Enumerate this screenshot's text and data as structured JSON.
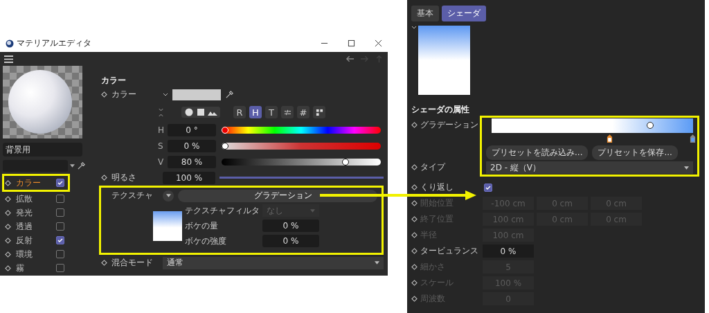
{
  "left_window": {
    "title": "マテリアルエディタ",
    "material_name": "背景用",
    "channels": [
      {
        "label": "カラー",
        "checked": true,
        "selected": true,
        "highlighted": true
      },
      {
        "label": "拡散",
        "checked": false,
        "selected": false,
        "highlighted": false
      },
      {
        "label": "発光",
        "checked": false,
        "selected": false,
        "highlighted": false
      },
      {
        "label": "透過",
        "checked": false,
        "selected": false,
        "highlighted": false
      },
      {
        "label": "反射",
        "checked": true,
        "selected": false,
        "highlighted": false
      },
      {
        "label": "環境",
        "checked": false,
        "selected": false,
        "highlighted": false
      },
      {
        "label": "霧",
        "checked": false,
        "selected": false,
        "highlighted": false
      }
    ],
    "section_title": "カラー",
    "color_label": "カラー",
    "mode_buttons": [
      {
        "kind": "text",
        "label": "R",
        "selected": false
      },
      {
        "kind": "text",
        "label": "H",
        "selected": true
      },
      {
        "kind": "text",
        "label": "T",
        "selected": false
      },
      {
        "kind": "mixer",
        "selected": false
      },
      {
        "kind": "text",
        "label": "#",
        "selected": false
      },
      {
        "kind": "swatches",
        "selected": false
      }
    ],
    "hsv": [
      {
        "kind": "hue",
        "label": "H",
        "value": "0 °",
        "level": 0
      },
      {
        "kind": "saturation",
        "label": "S",
        "value": "0 %",
        "level": 0
      },
      {
        "kind": "value",
        "label": "V",
        "value": "80 %",
        "level": 0.79
      }
    ],
    "brightness": {
      "label": "明るさ",
      "value": "100 %",
      "level": 1
    },
    "texture": {
      "highlighted": true,
      "label": "テクスチャ",
      "shader": "グラデーション",
      "filter_label": "テクスチャフィルタ",
      "filter_value": "なし",
      "blur_amount_label": "ボケの量",
      "blur_amount": "0 %",
      "blur_strength_label": "ボケの強度",
      "blur_strength": "0 %"
    },
    "blend_mode": {
      "label": "混合モード",
      "value": "通常"
    }
  },
  "shader_panel": {
    "tabs": [
      {
        "label": "基本",
        "selected": false
      },
      {
        "label": "シェーダ",
        "selected": true
      }
    ],
    "heading": "シェーダの属性",
    "gradient_label": "グラデーション",
    "gradient_highlighted": true,
    "preset_buttons": [
      "プリセットを読み込み...",
      "プリセットを保存..."
    ],
    "type": {
      "label": "タイプ",
      "value": "2D - 縦（V）"
    },
    "repeat": {
      "label": "くり返し",
      "checked": true
    },
    "params": [
      {
        "label": "開始位置",
        "values": [
          "-100 cm",
          "0 cm",
          "0 cm"
        ],
        "disabled": true
      },
      {
        "label": "終了位置",
        "values": [
          "100 cm",
          "0 cm",
          "0 cm"
        ],
        "disabled": true
      },
      {
        "label": "半径",
        "values": [
          "100 cm"
        ],
        "disabled": true
      },
      {
        "label": "タービュランス",
        "values": [
          "0 %"
        ],
        "disabled": false
      },
      {
        "label": "細かさ",
        "values": [
          "5"
        ],
        "disabled": true
      },
      {
        "label": "スケール",
        "values": [
          "100 %"
        ],
        "disabled": true
      },
      {
        "label": "周波数",
        "values": [
          "0"
        ],
        "disabled": true
      }
    ]
  }
}
